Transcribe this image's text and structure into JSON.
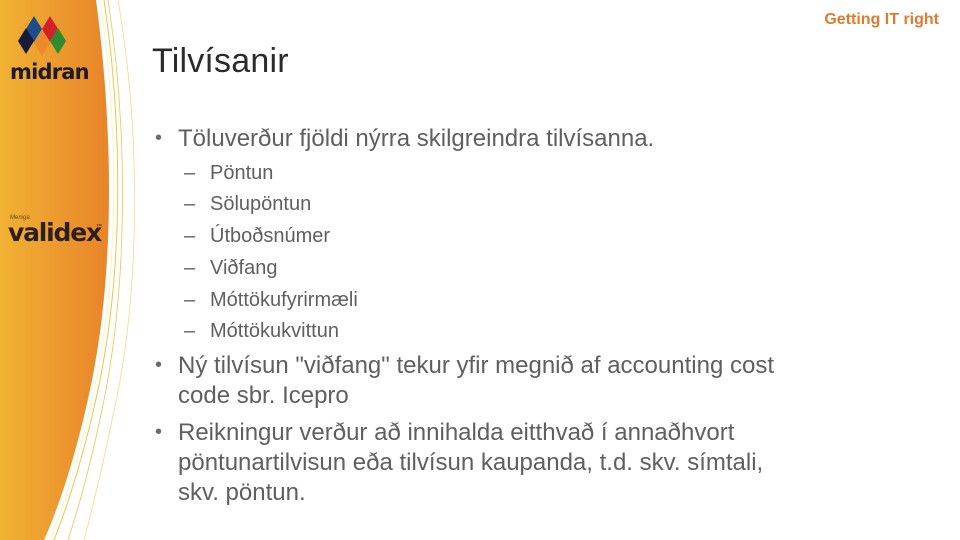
{
  "header": {
    "tagline": "Getting IT right"
  },
  "logos": {
    "midran": "midran",
    "validex_prefix": "Meniga",
    "validex": "validex",
    "validex_tm": "™"
  },
  "colors": {
    "sidebar_orange_light": "#f1b233",
    "sidebar_orange_dark": "#e8842a",
    "tagline": "#e07a30",
    "title": "#2b2b2b",
    "body_text": "#5f5f5f",
    "diamond_blue": "#1e4d8c",
    "diamond_red": "#d4202a",
    "diamond_navy": "#171a3a",
    "diamond_orange": "#ef8a2a",
    "diamond_green": "#2e8b2e"
  },
  "slide": {
    "title": "Tilvísanir",
    "bullets": [
      {
        "marker": "•",
        "text": "Töluverður fjöldi nýrra skilgreindra tilvísanna.",
        "subitems": [
          {
            "marker": "–",
            "text": "Pöntun"
          },
          {
            "marker": "–",
            "text": "Sölupöntun"
          },
          {
            "marker": "–",
            "text": "Útboðsnúmer"
          },
          {
            "marker": "–",
            "text": "Viðfang"
          },
          {
            "marker": "–",
            "text": "Móttökufyrirmæli"
          },
          {
            "marker": "–",
            "text": "Móttökukvittun"
          }
        ]
      },
      {
        "marker": "•",
        "lines": [
          "Ný tilvísun \"viðfang\" tekur yfir megnið af accounting cost",
          "code sbr. Icepro"
        ]
      },
      {
        "marker": "•",
        "lines": [
          "Reikningur verður að innihalda eitthvað í annaðhvort",
          "pöntunartilvisun eða tilvísun kaupanda, t.d. skv. símtali,",
          "skv. pöntun."
        ]
      }
    ]
  }
}
